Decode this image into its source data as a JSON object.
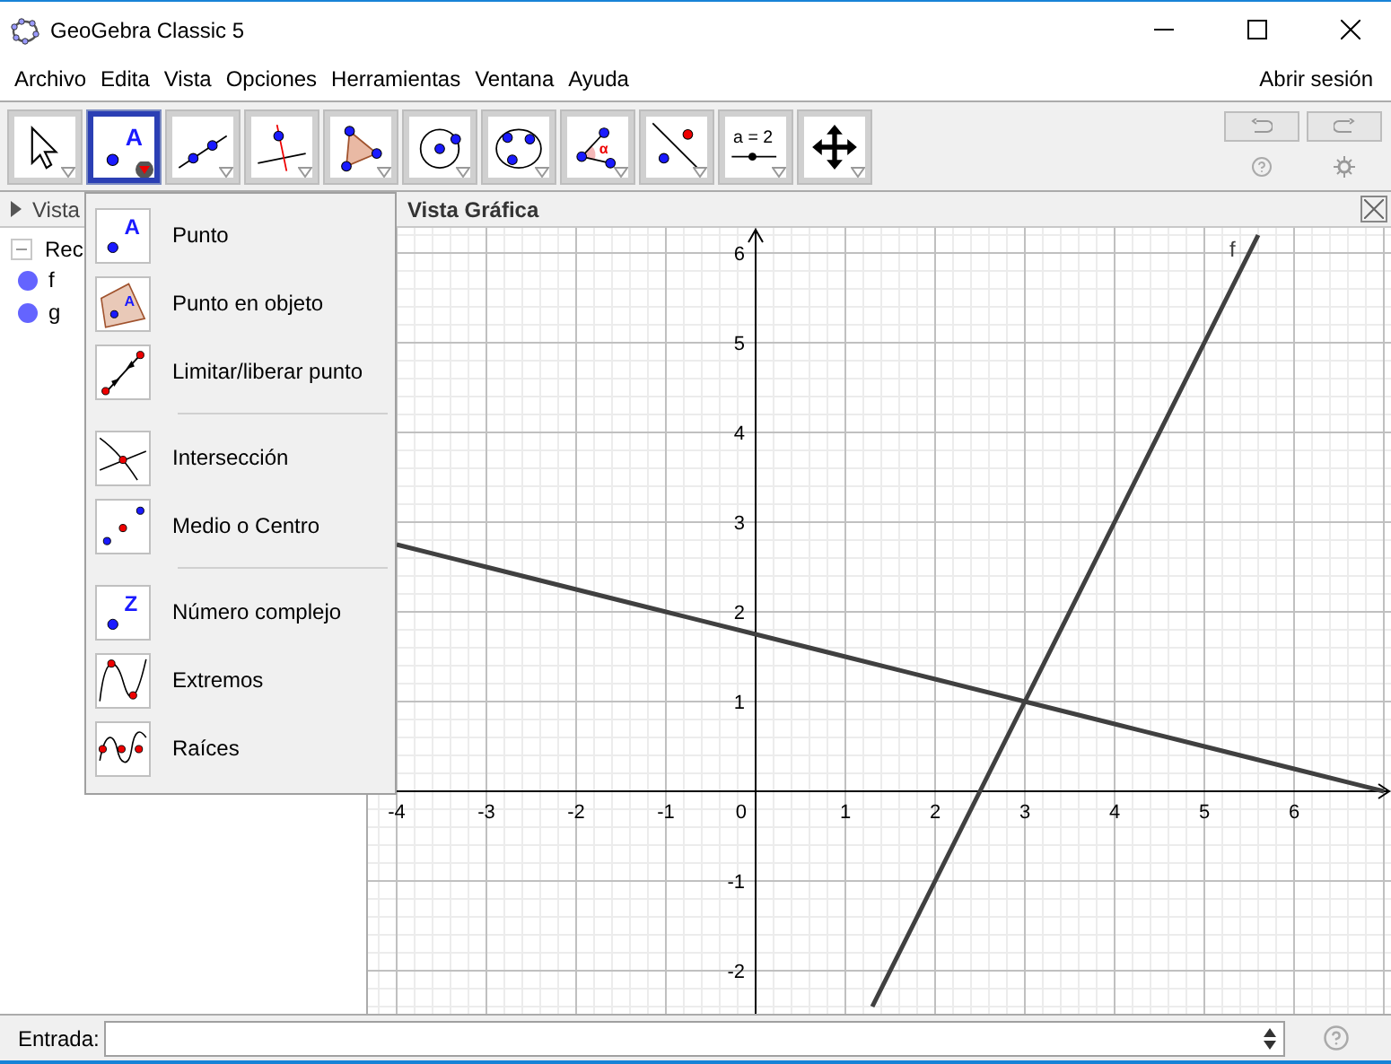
{
  "window": {
    "title": "GeoGebra Classic 5"
  },
  "menu_bar": [
    "Archivo",
    "Edita",
    "Vista",
    "Opciones",
    "Herramientas",
    "Ventana",
    "Ayuda"
  ],
  "login": "Abrir sesión",
  "toolbar": [
    {
      "kind": "move",
      "selected": false
    },
    {
      "kind": "point",
      "label": "A",
      "selected": true
    },
    {
      "kind": "line",
      "selected": false
    },
    {
      "kind": "perpendicular",
      "selected": false
    },
    {
      "kind": "polygon",
      "selected": false
    },
    {
      "kind": "circle",
      "selected": false
    },
    {
      "kind": "conic",
      "selected": false
    },
    {
      "kind": "angle",
      "label": "α",
      "selected": false
    },
    {
      "kind": "reflect",
      "selected": false
    },
    {
      "kind": "slider",
      "label": "a = 2",
      "selected": false
    },
    {
      "kind": "pan",
      "selected": false
    }
  ],
  "tool_menu": [
    [
      {
        "kind": "point",
        "icon_text": "A",
        "label": "Punto"
      },
      {
        "kind": "point_on_object",
        "icon_text": "A",
        "label": "Punto en objeto"
      },
      {
        "kind": "attach",
        "label": "Limitar/liberar punto"
      }
    ],
    [
      {
        "kind": "intersect",
        "label": "Intersección"
      },
      {
        "kind": "midpoint",
        "label": "Medio o Centro"
      }
    ],
    [
      {
        "kind": "point",
        "icon_text": "Z",
        "label": "Número complejo"
      },
      {
        "kind": "extremum",
        "label": "Extremos"
      },
      {
        "kind": "roots",
        "label": "Raíces"
      }
    ]
  ],
  "algebra_view": {
    "title": "Vista",
    "tree": {
      "label": "Rec",
      "expanded": true,
      "children": [
        {
          "label": "f"
        },
        {
          "label": "g"
        }
      ]
    }
  },
  "graphics_view": {
    "title": "Vista Gráfica",
    "chart_data": {
      "type": "line",
      "grid": true,
      "x": [
        -4,
        -3,
        -2,
        -1,
        0,
        1,
        1.3,
        2,
        3,
        4,
        5,
        5.6,
        6,
        7
      ],
      "series": [
        {
          "name": "f",
          "color": "#404040",
          "values": [
            null,
            null,
            null,
            null,
            null,
            null,
            -2.4,
            -1,
            1,
            3,
            5,
            6.2,
            null,
            null
          ]
        },
        {
          "color": "#404040",
          "values": [
            2.75,
            2.5,
            2.25,
            2,
            1.75,
            1.5,
            null,
            1.25,
            1,
            0.75,
            0.5,
            null,
            0.25,
            0
          ]
        }
      ],
      "xlim": [
        -4.32,
        7.08
      ],
      "ylim": [
        -2.48,
        6.28
      ],
      "xticks": [
        -4,
        -3,
        -2,
        -1,
        0,
        1,
        2,
        3,
        4,
        5,
        6
      ],
      "yticks": [
        -2,
        -1,
        1,
        2,
        3,
        4,
        5,
        6
      ]
    }
  },
  "input_bar": {
    "label": "Entrada:"
  }
}
